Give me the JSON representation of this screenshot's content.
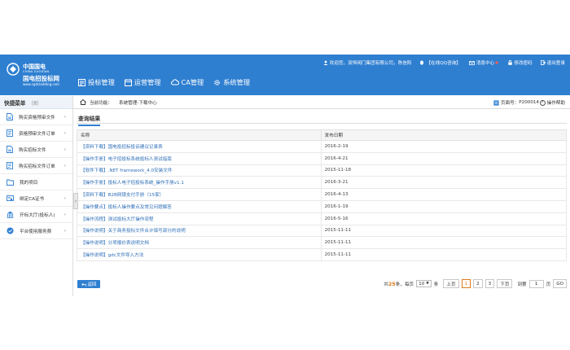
{
  "header": {
    "logo": {
      "company_cn": "中国国电",
      "company_en": "CHINA GUODIAN",
      "site_name": "国电招投标网",
      "site_url": "www.cgdcbidding.com"
    },
    "user": {
      "welcome": "欢迎您，双恒阀门集团有限公司，陈信阳",
      "qq": "【在线QQ咨询】",
      "messages": "消息中心",
      "change_password": "修改密码",
      "logout": "退出登录"
    },
    "nav": [
      "投标管理",
      "运营管理",
      "CA管理",
      "系统管理"
    ]
  },
  "sidebar": {
    "title": "快捷菜单",
    "count": "（8）",
    "items": [
      {
        "label": "购买资格预审文件",
        "icon": "document-icon"
      },
      {
        "label": "资格预审文件订单",
        "icon": "order-icon"
      },
      {
        "label": "购买招标文件",
        "icon": "document-icon"
      },
      {
        "label": "购买招标文件订单",
        "icon": "order-icon"
      },
      {
        "label": "我的项目",
        "icon": "folder-icon"
      },
      {
        "label": "绑定CA证书",
        "icon": "certificate-icon"
      },
      {
        "label": "开标大厅(投标人)",
        "icon": "hall-icon"
      },
      {
        "label": "平台使用服务费",
        "icon": "service-icon"
      }
    ]
  },
  "breadcrumb": {
    "label": "当前功能：",
    "path": "系统管理-下载中心"
  },
  "page_code": {
    "label": "页面号：",
    "value": "P200014"
  },
  "help": "操作帮助",
  "query_title": "查询结果",
  "table": {
    "headers": [
      "名称",
      "发布日期"
    ],
    "rows": [
      {
        "name": "【资料下载】国电投招标投诉建议记录表",
        "date": "2016-2-19"
      },
      {
        "name": "【操作手册】电子招投标系统投标人测试指南",
        "date": "2016-4-21"
      },
      {
        "name": "【软件下载】.NET framework_4.0安装文件",
        "date": "2015-11-18"
      },
      {
        "name": "【操作手册】投标人电子招投标系统_操作手册v1.1",
        "date": "2016-3-21"
      },
      {
        "name": "【资料下载】B2B网银支付手册（15家）",
        "date": "2016-4-13"
      },
      {
        "name": "【操作要点】投标人操作要点及常见问题解答",
        "date": "2016-1-19"
      },
      {
        "name": "【操作流程】测试投标大厅操作流程",
        "date": "2016-5-16"
      },
      {
        "name": "【操作说明】关于商务投标文件合计填写部分的说明",
        "date": "2015-11-11"
      },
      {
        "name": "【操作说明】分项报价表说明文档",
        "date": "2015-11-11"
      },
      {
        "name": "【操作说明】gdc文件导入方法",
        "date": "2015-11-11"
      }
    ]
  },
  "back_button": "返回",
  "pager": {
    "total_prefix": "共",
    "total": "25",
    "total_suffix": "条，每页",
    "per_page": "10",
    "per_page_suffix": "条",
    "prev": "上页",
    "pages": [
      "1",
      "2",
      "3"
    ],
    "next": "下页",
    "goto_label": "到第",
    "goto_value": "1",
    "goto_suffix": "页",
    "go": "GO"
  },
  "colors": {
    "primary": "#2f7fd1",
    "accent": "#e07a1a",
    "link": "#2f6fb8"
  }
}
